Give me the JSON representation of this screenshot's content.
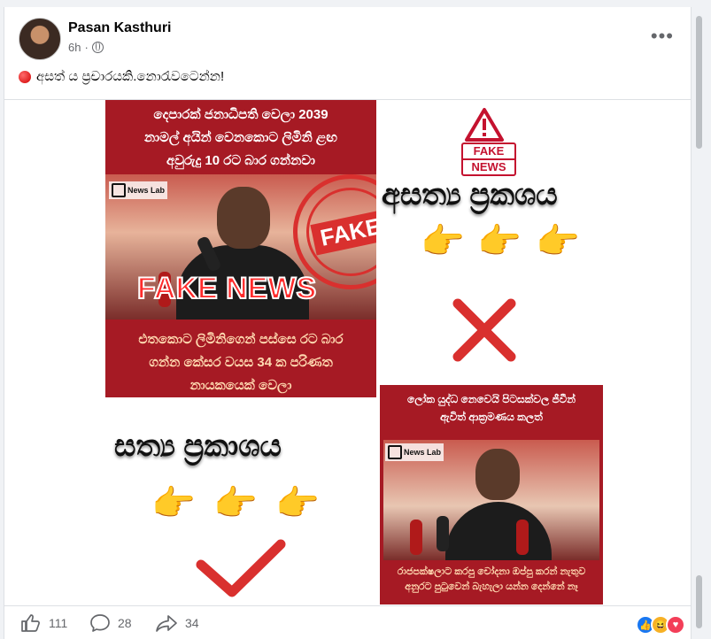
{
  "post": {
    "author": "Pasan Kasthuri",
    "time": "6h",
    "caption": "අසත් ය ප්‍රචාරයකි.නොරැවටෙන්න!"
  },
  "image": {
    "poster1": {
      "top_line1": "දෙපාරක් ජනාධිපති වෙලා 2039",
      "top_line2": "නාමල් අයින් වෙනකොට ලිමිනි ළඟ",
      "top_line3": "අවුරුදු 10 රට බාර ගන්නවා",
      "newslab": "News Lab",
      "fake_news": "FAKE NEWS",
      "stamp_word": "FAKE",
      "bottom_line1": "එතකොට ලිමිනිගෙන් පස්සෙ රට බාර",
      "bottom_line2": "ගන්න කේසර වයස 34 ක පරිණත",
      "bottom_line3": "නායකයෙක් වෙලා"
    },
    "fake_badge_line1": "FAKE",
    "fake_badge_line2": "NEWS",
    "asathya_label": "අසත්‍ය ප්‍රකශය",
    "sathya_label": "සත්‍ය ප්‍රකාශය",
    "poster2": {
      "top_line1": "ලෝක යුද්ධ නෙවෙයි පිටසක්වල ජීවීන්",
      "top_line2": "ඇවිත් ආක්‍රමණය කලත්",
      "newslab": "News Lab",
      "bottom_line1": "රාජපක්ෂලාට කරපු චෝදනා ඔප්පු කරන් නැතුව",
      "bottom_line2": "අනුරට පුටුවෙන් බැහැලා යන්න දෙන්නේ නෑ"
    }
  },
  "footer": {
    "likes": "111",
    "comments": "28",
    "shares": "34"
  }
}
